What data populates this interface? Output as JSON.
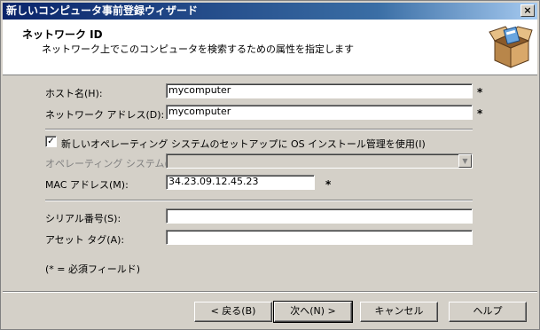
{
  "window": {
    "title": "新しいコンピュータ事前登録ウィザード",
    "close_glyph": "×"
  },
  "header": {
    "title": "ネットワーク ID",
    "subtitle": "ネットワーク上でこのコンピュータを検索するための属性を指定します"
  },
  "form": {
    "host_name_label": "ホスト名(H):",
    "host_name_value": "mycomputer",
    "network_address_label": "ネットワーク アドレス(D):",
    "network_address_value": "mycomputer",
    "required_mark": "*",
    "os_checkbox_label": "新しいオペレーティング システムのセットアップに OS インストール管理を使用(I)",
    "os_checkbox_checked": true,
    "check_glyph": "✓",
    "os_label": "オペレーティング システム(O):",
    "os_value": "",
    "dropdown_glyph": "▼",
    "mac_label": "MAC アドレス(M):",
    "mac_value": "34.23.09.12.45.23",
    "serial_label": "シリアル番号(S):",
    "serial_value": "",
    "asset_tag_label": "アセット タグ(A):",
    "asset_tag_value": "",
    "required_note": "(* = 必須フィールド)"
  },
  "buttons": {
    "back": "< 戻る(B)",
    "next": "次へ(N) >",
    "cancel": "キャンセル",
    "help": "ヘルプ"
  },
  "icons": {
    "header_icon": "open-box-icon"
  }
}
